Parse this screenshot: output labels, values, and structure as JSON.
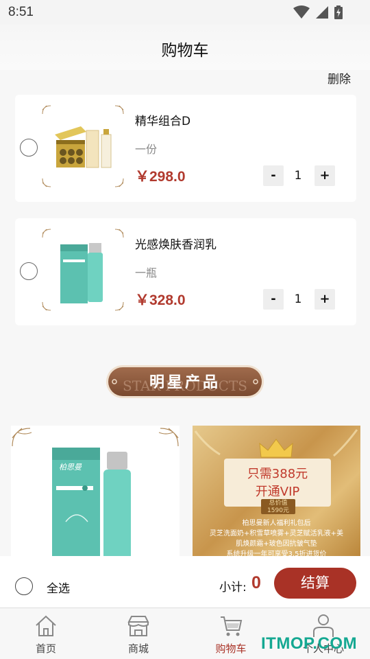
{
  "status_bar": {
    "time": "8:51",
    "icons": [
      "wifi-icon",
      "cell-signal-icon",
      "battery-charging-icon"
    ]
  },
  "header": {
    "title": "购物车",
    "delete_label": "删除"
  },
  "cart": {
    "items": [
      {
        "name": "精华组合D",
        "unit": "一份",
        "price": "￥298.0",
        "minus": "-",
        "quantity": "1",
        "plus": "+"
      },
      {
        "name": "光感焕肤香润乳",
        "unit": "一瓶",
        "price": "￥328.0",
        "minus": "-",
        "quantity": "1",
        "plus": "+"
      }
    ]
  },
  "star_products": {
    "title": "明星产品",
    "subtitle": "STAR PRODUCTS"
  },
  "promos": {
    "product_brand": "柏思曼",
    "vip": {
      "line1": "只需388元",
      "line2": "开通VIP",
      "value_label": "总价值",
      "value_amount": "1590元",
      "desc1": "柏思曼新人福利礼包后",
      "desc2": "灵芝洗面奶+积雪草喷雾+灵芝赋活乳液+美",
      "desc3": "肌焕颜霜+玻色因抗皱气垫",
      "desc4": "系统升级一年可享受3.5折进货价"
    }
  },
  "footer": {
    "select_all": "全选",
    "subtotal_label": "小计:",
    "subtotal_value": "0",
    "checkout": "结算"
  },
  "tabs": [
    {
      "label": "首页",
      "icon": "home-icon",
      "active": false
    },
    {
      "label": "商城",
      "icon": "store-icon",
      "active": false
    },
    {
      "label": "购物车",
      "icon": "cart-icon",
      "active": true
    },
    {
      "label": "个人中心",
      "icon": "user-icon",
      "active": false
    }
  ],
  "watermark": "ITMOP.COM",
  "colors": {
    "accent": "#a93226",
    "price": "#b13a2e",
    "watermark": "#15a892"
  }
}
